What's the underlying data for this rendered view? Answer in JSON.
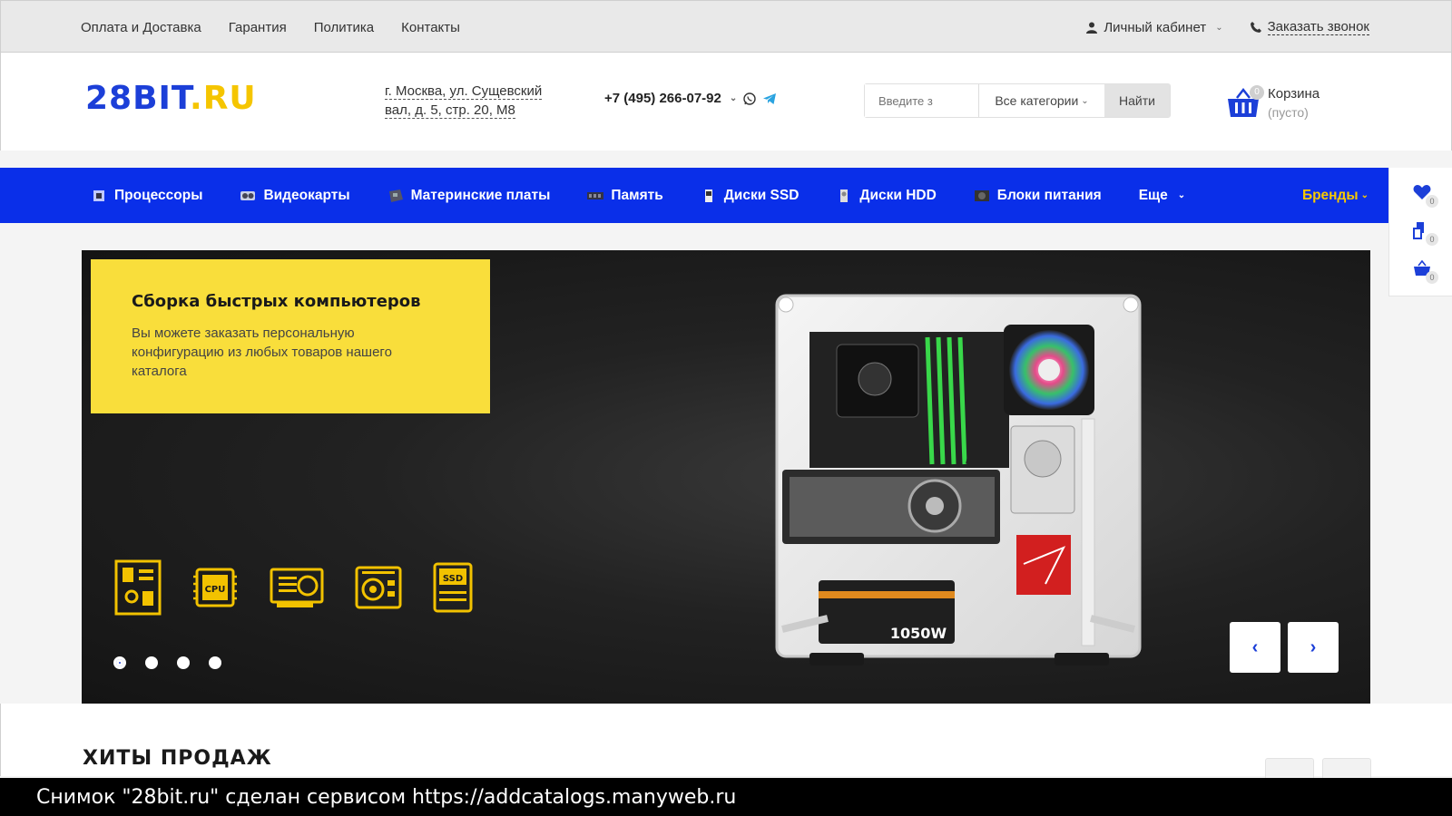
{
  "topbar": {
    "links": [
      "Оплата и Доставка",
      "Гарантия",
      "Политика",
      "Контакты"
    ],
    "account": "Личный кабинет",
    "callback": "Заказать звонок"
  },
  "header": {
    "logo_main": "28BIT",
    "logo_suffix": ".RU",
    "address_line1": "г. Москва, ул. Сущевский",
    "address_line2": "вал, д. 5, стр. 20, М8",
    "phone": "+7 (495) 266-07-92",
    "search": {
      "placeholder": "Введите з",
      "category": "Все категории",
      "button": "Найти"
    },
    "cart": {
      "count": "0",
      "title": "Корзина",
      "status": "(пусто)"
    }
  },
  "nav": {
    "items": [
      "Процессоры",
      "Видеокарты",
      "Материнские платы",
      "Память",
      "Диски SSD",
      "Диски HDD",
      "Блоки питания",
      "Еще"
    ],
    "brands": "Бренды"
  },
  "side": {
    "favorites_count": "0",
    "compare_count": "0",
    "basket_count": "0"
  },
  "hero": {
    "title": "Сборка быстрых компьютеров",
    "text": "Вы можете заказать персональную конфигурацию из любых товаров нашего каталога",
    "chip_labels": [
      "CPU",
      "SSD"
    ],
    "psu_label": "1050W",
    "slides": 4,
    "active_slide": 1
  },
  "section": {
    "title": "ХИТЫ ПРОДАЖ"
  },
  "caption": "Снимок \"28bit.ru\" сделан сервисом https://addcatalogs.manyweb.ru",
  "colors": {
    "brand_blue": "#0a2fe9",
    "brand_yellow": "#f9de3b",
    "hero_dark": "#1a1a1a"
  }
}
